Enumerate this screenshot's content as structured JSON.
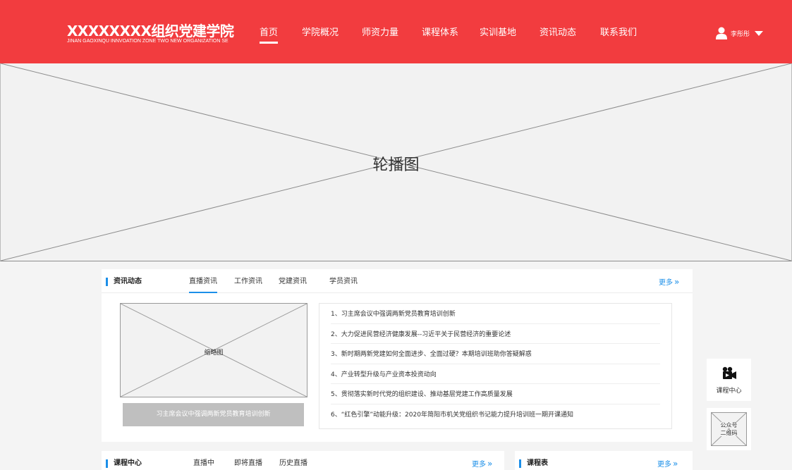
{
  "header": {
    "title": "XXXXXXXX组织党建学院",
    "subtitle": "JINAN GAOXINQU INNVOATION ZONE TWO NEW ORGANIZATION SE",
    "nav": [
      {
        "label": "首页",
        "active": true
      },
      {
        "label": "学院概况"
      },
      {
        "label": "师资力量"
      },
      {
        "label": "课程体系"
      },
      {
        "label": "实训基地"
      },
      {
        "label": "资讯动态"
      },
      {
        "label": "联系我们"
      }
    ],
    "user_name": "李彤彤",
    "colors": {
      "brand": "#f23c3f",
      "accent": "#1c8fe8"
    }
  },
  "banner": {
    "label": "轮播图"
  },
  "news": {
    "title": "资讯动态",
    "tabs": [
      "直播资讯",
      "工作资讯",
      "党建资讯",
      "学员资讯"
    ],
    "more": "更多",
    "thumb_label": "缩略图",
    "thumb_caption": "习主席会议中强调两新党员教育培训创新",
    "items": [
      "1、习主席会议中强调两新党员教育培训创新",
      "2、大力促进民营经济健康发展--习近平关于民营经济的重要论述",
      "3、新时期两新党建如何全面进步、全面过硬？本期培训班助你答疑解惑",
      "4、产业转型升级与产业资本投资动向",
      "5、贯彻落实新时代党的组织建设、推动基层党建工作高质量发展",
      "6、“红色引擎”动能升级：2020年简阳市机关党组织书记能力提升培训班一期开课通知"
    ]
  },
  "sidebar_float": {
    "course_center": "课程中心",
    "qr_line1": "公众号",
    "qr_line2": "二维码"
  },
  "course_center": {
    "title": "课程中心",
    "tabs": [
      "直播中",
      "即将直播",
      "历史直播"
    ],
    "more": "更多"
  },
  "schedule": {
    "title": "课程表",
    "more": "更多"
  }
}
